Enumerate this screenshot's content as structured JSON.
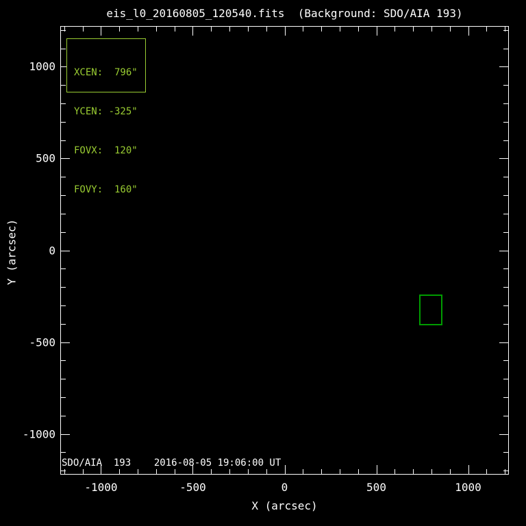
{
  "figure": {
    "background": "#000000",
    "text_color": "#FFFFFF"
  },
  "chart_data": {
    "type": "scatter",
    "subtype": "solar-fov-overlay-plot",
    "title": "eis_l0_20160805_120540.fits  (Background: SDO/AIA 193)",
    "xlabel": "X (arcsec)",
    "ylabel": "Y (arcsec)",
    "xlim": [
      -1222,
      1222
    ],
    "ylim": [
      -1222,
      1222
    ],
    "grid": false,
    "legend": false,
    "axis_color": "#FFFFFF",
    "major_tick_step": 500,
    "minor_tick_step": 100,
    "x_major_ticks": [
      -1000,
      -500,
      0,
      500,
      1000
    ],
    "x_tick_labels": [
      "-1000",
      "-500",
      "0",
      "500",
      "1000"
    ],
    "y_major_ticks": [
      -1000,
      -500,
      0,
      500,
      1000
    ],
    "y_tick_labels": [
      "-1000",
      "-500",
      "0",
      "500",
      "1000"
    ],
    "fov_box": {
      "xcen": 796,
      "ycen": -325,
      "fovx": 120,
      "fovy": 160,
      "color": "#009C00"
    },
    "info_box": {
      "color": "#9ACD32",
      "lines": [
        "XCEN:  796\"",
        "YCEN: -325\"",
        "FOVX:  120\"",
        "FOVY:  160\""
      ]
    },
    "background_caption": "SDO/AIA  193    2016-08-05 19:06:00 UT"
  }
}
